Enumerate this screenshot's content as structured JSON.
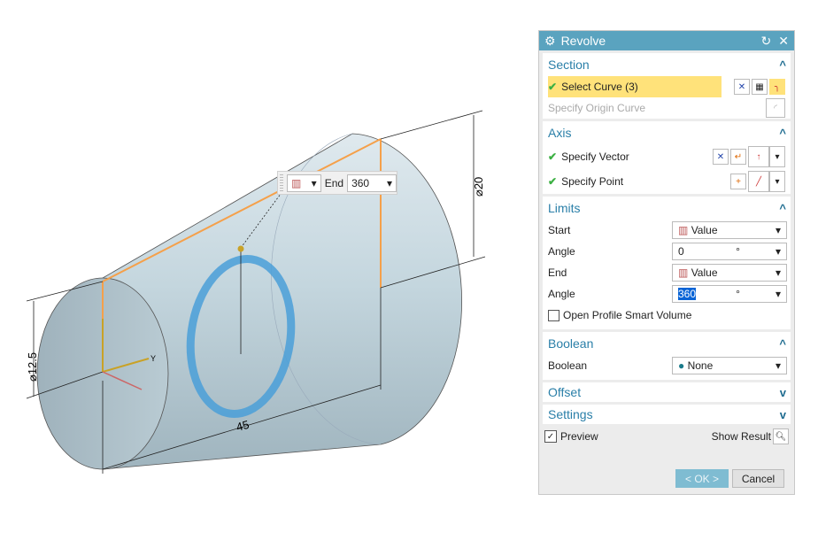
{
  "viewport": {
    "dim_length": "45",
    "dim_large_dia": "⌀20",
    "dim_small_dia": "⌀12.5",
    "axis_y": "Y",
    "mini_toolbar": {
      "end_label": "End",
      "end_value": "360"
    }
  },
  "dialog": {
    "title": "Revolve",
    "section": {
      "title": "Section",
      "select_curve": "Select Curve (3)",
      "origin_curve": "Specify Origin Curve"
    },
    "axis": {
      "title": "Axis",
      "vector": "Specify Vector",
      "point": "Specify Point"
    },
    "limits": {
      "title": "Limits",
      "start_label": "Start",
      "start_value": "Value",
      "angle1_label": "Angle",
      "angle1_value": "0",
      "end_label": "End",
      "end_value": "Value",
      "angle2_label": "Angle",
      "angle2_value": "360",
      "unit": "°",
      "open_profile": "Open Profile Smart Volume",
      "open_profile_checked": false
    },
    "boolean": {
      "title": "Boolean",
      "label": "Boolean",
      "value": "None"
    },
    "offset": {
      "title": "Offset"
    },
    "settings": {
      "title": "Settings"
    },
    "preview": "Preview",
    "preview_checked": true,
    "show_result": "Show Result",
    "ok": "< OK >",
    "cancel": "Cancel"
  },
  "colors": {
    "title_bar": "#5aa3bf",
    "highlight": "#ffe27a",
    "edge": "#f5a04a",
    "ring": "#4a9fd8"
  }
}
